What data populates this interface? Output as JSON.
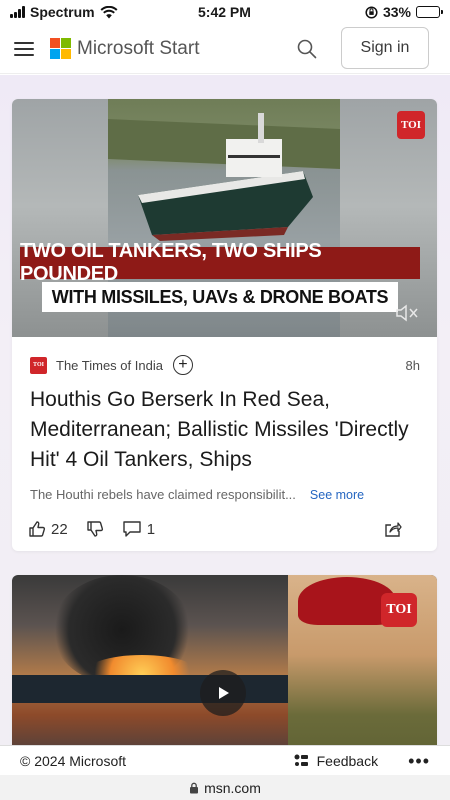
{
  "status_bar": {
    "carrier": "Spectrum",
    "time": "5:42 PM",
    "battery": "33%",
    "battery_level": 0.33
  },
  "header": {
    "brand": "Microsoft Start",
    "signin_label": "Sign in",
    "logo_colors": [
      "#f25022",
      "#7fba00",
      "#00a4ef",
      "#ffb900"
    ]
  },
  "articles": [
    {
      "image_caption_line1": "TWO OIL TANKERS, TWO SHIPS POUNDED",
      "image_caption_line2": "WITH MISSILES, UAVs & DRONE BOATS",
      "badge": "TOI",
      "source": "The Times of India",
      "age": "8h",
      "headline": "Houthis Go Berserk In Red Sea, Mediterranean; Ballistic Missiles 'Directly Hit' 4 Oil Tankers, Ships",
      "snippet": "The Houthi rebels have claimed responsibilit...",
      "see_more": "See more",
      "likes": "22",
      "comments": "1"
    },
    {
      "badge": "TOI"
    }
  ],
  "footer": {
    "copyright": "© 2024 Microsoft",
    "feedback": "Feedback",
    "more": "•••"
  },
  "url_bar": {
    "domain": "msn.com"
  },
  "colors": {
    "accent_link": "#2566c1",
    "toi_red": "#d0262a",
    "caption_red": "#8e1a17"
  }
}
